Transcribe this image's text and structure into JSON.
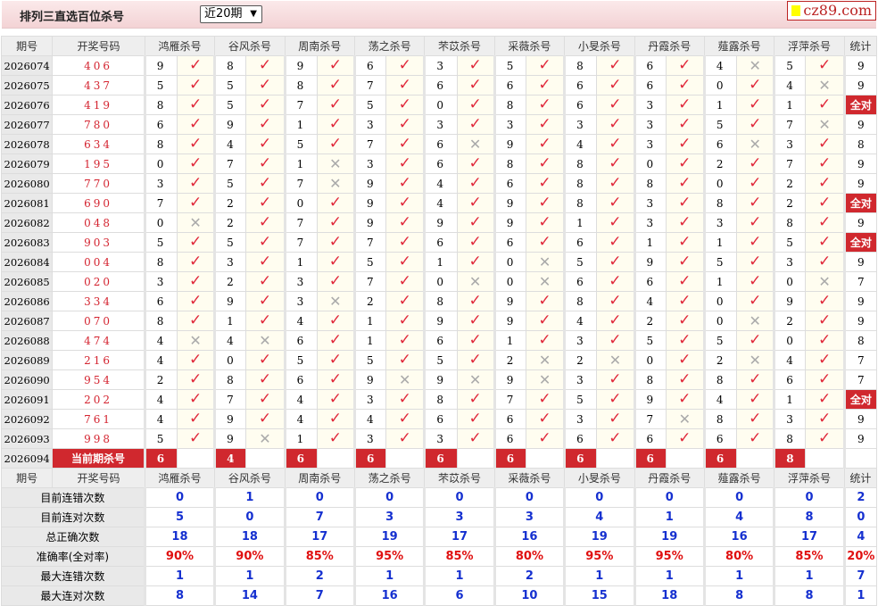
{
  "header": {
    "title": "排列三直选百位杀号",
    "range_select": "近20期",
    "logo": "cz89.com"
  },
  "columns": {
    "period": "期号",
    "draw": "开奖号码",
    "stat": "统计",
    "predictors": [
      "鸿雁杀号",
      "谷风杀号",
      "周南杀号",
      "荡之杀号",
      "芣苡杀号",
      "采薇杀号",
      "小旻杀号",
      "丹霞杀号",
      "薤露杀号",
      "浮萍杀号"
    ]
  },
  "rows": [
    {
      "period": "2026074",
      "draw": "406",
      "picks": [
        9,
        8,
        9,
        6,
        3,
        5,
        8,
        6,
        4,
        5
      ],
      "hits": [
        1,
        1,
        1,
        1,
        1,
        1,
        1,
        1,
        0,
        1
      ],
      "stat": "9"
    },
    {
      "period": "2026075",
      "draw": "437",
      "picks": [
        5,
        5,
        8,
        7,
        6,
        6,
        6,
        6,
        0,
        4
      ],
      "hits": [
        1,
        1,
        1,
        1,
        1,
        1,
        1,
        1,
        1,
        0
      ],
      "stat": "9"
    },
    {
      "period": "2026076",
      "draw": "419",
      "picks": [
        8,
        5,
        7,
        5,
        0,
        8,
        6,
        3,
        1,
        1
      ],
      "hits": [
        1,
        1,
        1,
        1,
        1,
        1,
        1,
        1,
        1,
        1
      ],
      "stat": "全对"
    },
    {
      "period": "2026077",
      "draw": "780",
      "picks": [
        6,
        9,
        1,
        3,
        3,
        3,
        3,
        3,
        5,
        7
      ],
      "hits": [
        1,
        1,
        1,
        1,
        1,
        1,
        1,
        1,
        1,
        0
      ],
      "stat": "9"
    },
    {
      "period": "2026078",
      "draw": "634",
      "picks": [
        8,
        4,
        5,
        7,
        6,
        9,
        4,
        3,
        6,
        3
      ],
      "hits": [
        1,
        1,
        1,
        1,
        0,
        1,
        1,
        1,
        0,
        1
      ],
      "stat": "8"
    },
    {
      "period": "2026079",
      "draw": "195",
      "picks": [
        0,
        7,
        1,
        3,
        6,
        8,
        8,
        0,
        2,
        7
      ],
      "hits": [
        1,
        1,
        0,
        1,
        1,
        1,
        1,
        1,
        1,
        1
      ],
      "stat": "9"
    },
    {
      "period": "2026080",
      "draw": "770",
      "picks": [
        3,
        5,
        7,
        9,
        4,
        6,
        8,
        8,
        0,
        2
      ],
      "hits": [
        1,
        1,
        0,
        1,
        1,
        1,
        1,
        1,
        1,
        1
      ],
      "stat": "9"
    },
    {
      "period": "2026081",
      "draw": "690",
      "picks": [
        7,
        2,
        0,
        9,
        4,
        9,
        8,
        3,
        8,
        2
      ],
      "hits": [
        1,
        1,
        1,
        1,
        1,
        1,
        1,
        1,
        1,
        1
      ],
      "stat": "全对"
    },
    {
      "period": "2026082",
      "draw": "048",
      "picks": [
        0,
        2,
        7,
        9,
        9,
        9,
        1,
        3,
        3,
        8
      ],
      "hits": [
        0,
        1,
        1,
        1,
        1,
        1,
        1,
        1,
        1,
        1
      ],
      "stat": "9"
    },
    {
      "period": "2026083",
      "draw": "903",
      "picks": [
        5,
        5,
        7,
        7,
        6,
        6,
        6,
        1,
        1,
        5
      ],
      "hits": [
        1,
        1,
        1,
        1,
        1,
        1,
        1,
        1,
        1,
        1
      ],
      "stat": "全对"
    },
    {
      "period": "2026084",
      "draw": "004",
      "picks": [
        8,
        3,
        1,
        5,
        1,
        0,
        5,
        9,
        5,
        3
      ],
      "hits": [
        1,
        1,
        1,
        1,
        1,
        0,
        1,
        1,
        1,
        1
      ],
      "stat": "9"
    },
    {
      "period": "2026085",
      "draw": "020",
      "picks": [
        3,
        2,
        3,
        7,
        0,
        0,
        6,
        6,
        1,
        0
      ],
      "hits": [
        1,
        1,
        1,
        1,
        0,
        0,
        1,
        1,
        1,
        0
      ],
      "stat": "7"
    },
    {
      "period": "2026086",
      "draw": "334",
      "picks": [
        6,
        9,
        3,
        2,
        8,
        9,
        8,
        4,
        0,
        9
      ],
      "hits": [
        1,
        1,
        0,
        1,
        1,
        1,
        1,
        1,
        1,
        1
      ],
      "stat": "9"
    },
    {
      "period": "2026087",
      "draw": "070",
      "picks": [
        8,
        1,
        4,
        1,
        9,
        9,
        4,
        2,
        0,
        2
      ],
      "hits": [
        1,
        1,
        1,
        1,
        1,
        1,
        1,
        1,
        0,
        1
      ],
      "stat": "9"
    },
    {
      "period": "2026088",
      "draw": "474",
      "picks": [
        4,
        4,
        6,
        1,
        6,
        1,
        3,
        5,
        5,
        0
      ],
      "hits": [
        0,
        0,
        1,
        1,
        1,
        1,
        1,
        1,
        1,
        1
      ],
      "stat": "8"
    },
    {
      "period": "2026089",
      "draw": "216",
      "picks": [
        4,
        0,
        5,
        5,
        5,
        2,
        2,
        0,
        2,
        4
      ],
      "hits": [
        1,
        1,
        1,
        1,
        1,
        0,
        0,
        1,
        0,
        1
      ],
      "stat": "7"
    },
    {
      "period": "2026090",
      "draw": "954",
      "picks": [
        2,
        8,
        6,
        9,
        9,
        9,
        3,
        8,
        8,
        6
      ],
      "hits": [
        1,
        1,
        1,
        0,
        0,
        0,
        1,
        1,
        1,
        1
      ],
      "stat": "7"
    },
    {
      "period": "2026091",
      "draw": "202",
      "picks": [
        4,
        7,
        4,
        3,
        8,
        7,
        5,
        9,
        4,
        1
      ],
      "hits": [
        1,
        1,
        1,
        1,
        1,
        1,
        1,
        1,
        1,
        1
      ],
      "stat": "全对"
    },
    {
      "period": "2026092",
      "draw": "761",
      "picks": [
        4,
        9,
        4,
        4,
        6,
        6,
        3,
        7,
        8,
        3
      ],
      "hits": [
        1,
        1,
        1,
        1,
        1,
        1,
        1,
        0,
        1,
        1
      ],
      "stat": "9"
    },
    {
      "period": "2026093",
      "draw": "998",
      "picks": [
        5,
        9,
        1,
        3,
        3,
        6,
        6,
        6,
        6,
        8
      ],
      "hits": [
        1,
        0,
        1,
        1,
        1,
        1,
        1,
        1,
        1,
        1
      ],
      "stat": "9"
    }
  ],
  "current": {
    "period": "2026094",
    "label": "当前期杀号",
    "picks": [
      6,
      4,
      6,
      6,
      6,
      6,
      6,
      6,
      6,
      8
    ]
  },
  "stats": [
    {
      "label": "目前连错次数",
      "values": [
        "0",
        "1",
        "0",
        "0",
        "0",
        "0",
        "0",
        "0",
        "0",
        "0"
      ],
      "stat": "2"
    },
    {
      "label": "目前连对次数",
      "values": [
        "5",
        "0",
        "7",
        "3",
        "3",
        "3",
        "4",
        "1",
        "4",
        "8"
      ],
      "stat": "0"
    },
    {
      "label": "总正确次数",
      "values": [
        "18",
        "18",
        "17",
        "19",
        "17",
        "16",
        "19",
        "19",
        "16",
        "17"
      ],
      "stat": "4"
    },
    {
      "label": "准确率(全对率)",
      "values": [
        "90%",
        "90%",
        "85%",
        "95%",
        "85%",
        "80%",
        "95%",
        "95%",
        "80%",
        "85%"
      ],
      "stat": "20%",
      "accent": true
    },
    {
      "label": "最大连错次数",
      "values": [
        "1",
        "1",
        "2",
        "1",
        "1",
        "2",
        "1",
        "1",
        "1",
        "1"
      ],
      "stat": "7"
    },
    {
      "label": "最大连对次数",
      "values": [
        "8",
        "14",
        "7",
        "16",
        "6",
        "10",
        "15",
        "18",
        "8",
        "8"
      ],
      "stat": "1"
    }
  ],
  "marks": {
    "hit": "✓",
    "miss": "✕"
  },
  "colors": {
    "accent": "#d0282e",
    "value": "#1530d0"
  }
}
